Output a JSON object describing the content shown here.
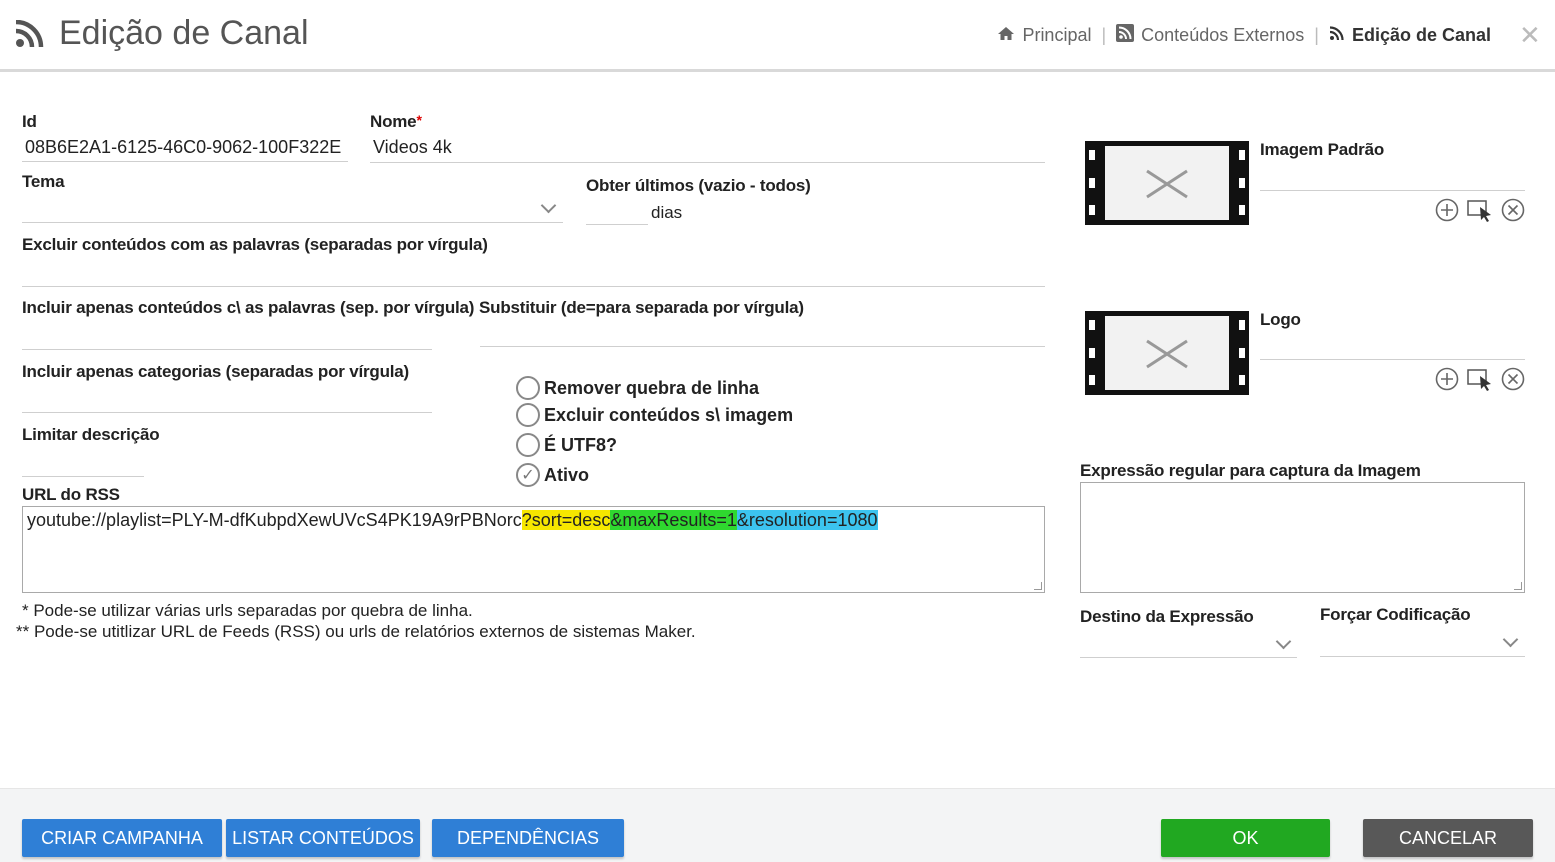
{
  "header": {
    "title": "Edição de Canal",
    "breadcrumb": [
      {
        "label": "Principal",
        "icon": "home-icon"
      },
      {
        "label": "Conteúdos Externos",
        "icon": "rss-square-icon"
      },
      {
        "label": "Edição de Canal",
        "icon": "rss-icon"
      }
    ],
    "close_icon": "close-icon"
  },
  "form": {
    "id": {
      "label": "Id",
      "value": "08B6E2A1-6125-46C0-9062-100F322E"
    },
    "nome": {
      "label": "Nome",
      "required_mark": "*",
      "value": "Videos 4k"
    },
    "tema": {
      "label": "Tema",
      "value": ""
    },
    "obter": {
      "label": "Obter últimos (vazio - todos)",
      "value": "",
      "suffix": "dias"
    },
    "excluir_palavras": {
      "label": "Excluir conteúdos com as palavras (separadas por vírgula)",
      "value": ""
    },
    "incluir_palavras": {
      "label": "Incluir apenas conteúdos c\\ as palavras (sep. por vírgula)",
      "value": ""
    },
    "substituir": {
      "label": "Substituir (de=para separada por vírgula)",
      "value": ""
    },
    "incluir_categorias": {
      "label": "Incluir apenas categorias (separadas por vírgula)",
      "value": ""
    },
    "limitar_descricao": {
      "label": "Limitar descrição",
      "value": ""
    },
    "checkboxes": [
      {
        "label": "Remover quebra de linha",
        "checked": false
      },
      {
        "label": "Excluir conteúdos s\\ imagem",
        "checked": false
      },
      {
        "label": "É UTF8?",
        "checked": false
      },
      {
        "label": "Ativo",
        "checked": true
      }
    ],
    "url_rss": {
      "label": "URL do RSS",
      "value_parts": {
        "base": "youtube://playlist=PLY-M-dfKubpdXewUVcS4PK19A9rPBNorc",
        "sort": "?sort=desc",
        "max": "&maxResults=1",
        "res": "&resolution=1080 "
      }
    },
    "notes": [
      "* Pode-se utilizar várias urls separadas por quebra de linha.",
      "** Pode-se utitlizar URL de Feeds (RSS) ou urls de relatórios externos de sistemas Maker."
    ],
    "imagem_padrao": {
      "label": "Imagem Padrão",
      "value": ""
    },
    "logo": {
      "label": "Logo",
      "value": ""
    },
    "expressao": {
      "label": "Expressão regular para captura da Imagem",
      "value": ""
    },
    "destino": {
      "label": "Destino da Expressão",
      "value": ""
    },
    "forcar": {
      "label": "Forçar Codificação",
      "value": ""
    }
  },
  "footer": {
    "criar_campanha": "CRIAR CAMPANHA",
    "listar_conteudos": "LISTAR CONTEÚDOS",
    "dependencias": "DEPENDÊNCIAS",
    "ok": "OK",
    "cancelar": "CANCELAR"
  },
  "colors": {
    "primary_button": "#2f7fd6",
    "ok_button": "#21a821",
    "cancel_button": "#585858",
    "highlight_yellow": "#f6e700",
    "highlight_green": "#2fd82f",
    "highlight_blue": "#3cc4ef"
  }
}
